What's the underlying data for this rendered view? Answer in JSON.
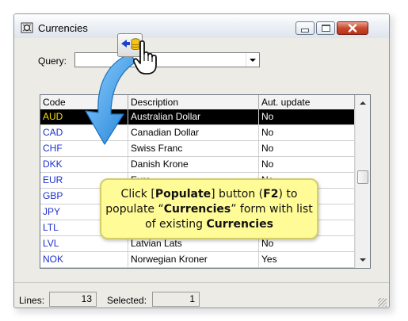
{
  "window": {
    "title": "Currencies"
  },
  "query": {
    "label": "Query:",
    "value": ""
  },
  "table": {
    "columns": [
      "Code",
      "Description",
      "Aut. update"
    ],
    "rows": [
      {
        "code": "AUD",
        "description": "Australian Dollar",
        "auto_update": "No",
        "selected": true
      },
      {
        "code": "CAD",
        "description": "Canadian Dollar",
        "auto_update": "No"
      },
      {
        "code": "CHF",
        "description": "Swiss Franc",
        "auto_update": "No"
      },
      {
        "code": "DKK",
        "description": "Danish Krone",
        "auto_update": "No"
      },
      {
        "code": "EUR",
        "description": "Euro",
        "auto_update": "No"
      },
      {
        "code": "GBP",
        "description": "",
        "auto_update": ""
      },
      {
        "code": "JPY",
        "description": "",
        "auto_update": ""
      },
      {
        "code": "LTL",
        "description": "",
        "auto_update": ""
      },
      {
        "code": "LVL",
        "description": "Latvian Lats",
        "auto_update": "No"
      },
      {
        "code": "NOK",
        "description": "Norwegian Kroner",
        "auto_update": "Yes"
      }
    ]
  },
  "status": {
    "lines_label": "Lines:",
    "lines_value": "13",
    "selected_label": "Selected:",
    "selected_value": "1"
  },
  "callout": {
    "part1": "Click [",
    "bold1": "Populate",
    "part2": "] button (",
    "bold2": "F2",
    "part3": ") to populate “",
    "bold3": "Currencies",
    "part4": "” form with list of existing ",
    "bold4": "Currencies"
  },
  "icons": {
    "app": "currencies-app-icon",
    "populate": "populate-database-icon",
    "pointer": "hand-pointer-icon"
  },
  "colors": {
    "code_text": "#1c2fd0",
    "selected_bg": "#000000",
    "selected_code": "#ffde00",
    "callout_bg": "#fffb97",
    "arrow": "#2a8fe0"
  }
}
